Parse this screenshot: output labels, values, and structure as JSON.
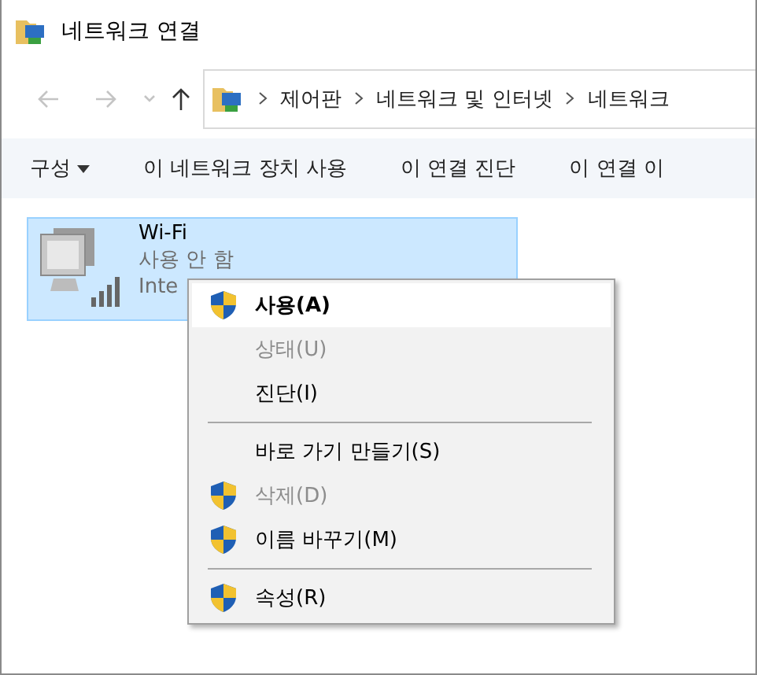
{
  "window": {
    "title": "네트워크 연결"
  },
  "address": {
    "crumbs": [
      "제어판",
      "네트워크 및 인터넷",
      "네트워크"
    ]
  },
  "commands": [
    {
      "label": "구성",
      "dropdown": true
    },
    {
      "label": "이 네트워크 장치 사용",
      "dropdown": false
    },
    {
      "label": "이 연결 진단",
      "dropdown": false
    },
    {
      "label": "이 연결 이",
      "dropdown": false
    }
  ],
  "connection": {
    "name": "Wi-Fi",
    "status": "사용 안 함",
    "device": "Inte",
    "selected": true
  },
  "context_menu": [
    {
      "kind": "item",
      "label": "사용(A)",
      "shield": true,
      "disabled": false,
      "selected": true,
      "default": true
    },
    {
      "kind": "item",
      "label": "상태(U)",
      "shield": false,
      "disabled": true,
      "selected": false,
      "default": false
    },
    {
      "kind": "item",
      "label": "진단(I)",
      "shield": false,
      "disabled": false,
      "selected": false,
      "default": false
    },
    {
      "kind": "separator"
    },
    {
      "kind": "item",
      "label": "바로 가기 만들기(S)",
      "shield": false,
      "disabled": false,
      "selected": false,
      "default": false
    },
    {
      "kind": "item",
      "label": "삭제(D)",
      "shield": true,
      "disabled": true,
      "selected": false,
      "default": false
    },
    {
      "kind": "item",
      "label": "이름 바꾸기(M)",
      "shield": true,
      "disabled": false,
      "selected": false,
      "default": false
    },
    {
      "kind": "separator"
    },
    {
      "kind": "item",
      "label": "속성(R)",
      "shield": true,
      "disabled": false,
      "selected": false,
      "default": false
    }
  ]
}
